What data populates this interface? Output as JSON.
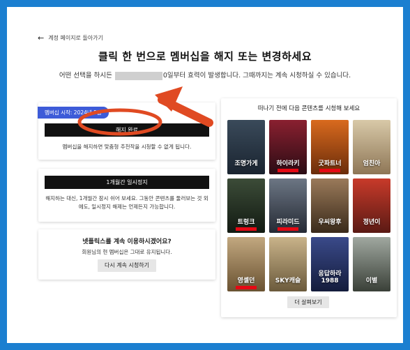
{
  "page": {
    "back_label": "계정 페이지로 돌아가기",
    "title": "클릭 한 번으로 멤버십을 해지 또는 변경하세요",
    "subtitle_before": "어떤 선택을 하시든 ",
    "subtitle_after": "0일부터 효력이 발생합니다. 그때까지는 계속 시청하실 수 있습니다."
  },
  "cancel_card": {
    "badge": "멤버십 시작: 2024년 5월",
    "button": "해지 완료",
    "note": "멤버십을 해지하면 맞춤형 추천작을 시청할 수 없게 됩니다."
  },
  "pause_card": {
    "button": "1개월간 일시정지",
    "note": "해지하는 대신, 1개월간 잠시 쉬어 보세요. 그동안 콘텐츠를 둘러보는 것 외에도, 일시정지 해제는 언제든지 가능합니다."
  },
  "continue_card": {
    "question": "넷플릭스를 계속 이용하시겠어요?",
    "note": "회원님의 현 멤버십은 그대로 유지됩니다.",
    "button": "다시 계속 시청하기"
  },
  "watch_card": {
    "heading": "떠나기 전에 다음 콘텐츠를 시청해 보세요",
    "more_button": "더 살펴보기",
    "posters": [
      {
        "title": "조명가게",
        "color_top": "#3a4a5a",
        "color_bottom": "#1a2430",
        "badge": false
      },
      {
        "title": "하이라키",
        "color_top": "#8a2030",
        "color_bottom": "#2a0c14",
        "badge": true
      },
      {
        "title": "굿파트너",
        "color_top": "#d96a1e",
        "color_bottom": "#6a2c0a",
        "badge": true
      },
      {
        "title": "엄친아",
        "color_top": "#d8c9a8",
        "color_bottom": "#8e7656",
        "badge": false
      },
      {
        "title": "트렁크",
        "color_top": "#3c4c38",
        "color_bottom": "#121a12",
        "badge": true
      },
      {
        "title": "피라미드",
        "color_top": "#6c7684",
        "color_bottom": "#252a34",
        "badge": true
      },
      {
        "title": "우씨왕후",
        "color_top": "#9a7a5a",
        "color_bottom": "#3a2a1a",
        "badge": false
      },
      {
        "title": "정년이",
        "color_top": "#c83a2a",
        "color_bottom": "#5a1a14",
        "badge": false
      },
      {
        "title": "영셸던",
        "color_top": "#c2a880",
        "color_bottom": "#6a5232",
        "badge": true
      },
      {
        "title": "SKY캐슬",
        "color_top": "#c9b38a",
        "color_bottom": "#6b5a3c",
        "badge": false
      },
      {
        "title": "응답하라 1988",
        "color_top": "#3a4a8a",
        "color_bottom": "#141c3c",
        "badge": false
      },
      {
        "title": "이별",
        "color_top": "#a0a8a0",
        "color_bottom": "#3a4038",
        "badge": false
      }
    ]
  }
}
